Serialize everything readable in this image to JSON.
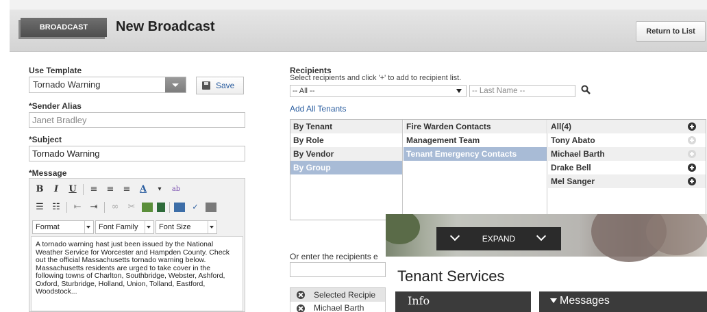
{
  "header": {
    "tag": "BROADCAST",
    "title": "New Broadcast",
    "return_label": "Return to List"
  },
  "form": {
    "template_label": "Use Template",
    "template_value": "Tornado Warning",
    "save_label": "Save",
    "sender_label": "*Sender Alias",
    "sender_value": "Janet Bradley",
    "subject_label": "*Subject",
    "subject_value": "Tornado Warning",
    "message_label": "*Message",
    "editor": {
      "format": "Format",
      "font_family": "Font Family",
      "font_size": "Font Size",
      "body": "A tornado warning hast just been issued by the National Weather Service for Worcester and Hampden County. Check out the official Massachusetts tornado warning below. Massachusetts residents are urged to take cover in the following towns of Charlton, Southbridge, Webster, Ashford, Oxford, Sturbridge, Holland, Union, Tolland, Eastford, Woodstock..."
    }
  },
  "recipients": {
    "label": "Recipients",
    "hint": "Select recipients and click '+' to add to recipient list.",
    "filter_value": "-- All --",
    "lastname_placeholder": "-- Last Name --",
    "add_all": "Add All Tenants",
    "categories": [
      "By Tenant",
      "By Role",
      "By Vendor",
      "By Group"
    ],
    "groups": [
      "Fire Warden Contacts",
      "Management Team",
      "Tenant Emergency Contacts"
    ],
    "people": [
      "All(4)",
      "Tony Abato",
      "Michael Barth",
      "Drake Bell",
      "Mel Sanger"
    ],
    "or_enter": "Or enter the recipients e",
    "selected_header": "Selected Recipie",
    "selected_first": "Michael Barth"
  },
  "overlay": {
    "expand": "EXPAND",
    "title": "Tenant Services",
    "tab_info": "Info",
    "tab_messages": "Messages"
  }
}
